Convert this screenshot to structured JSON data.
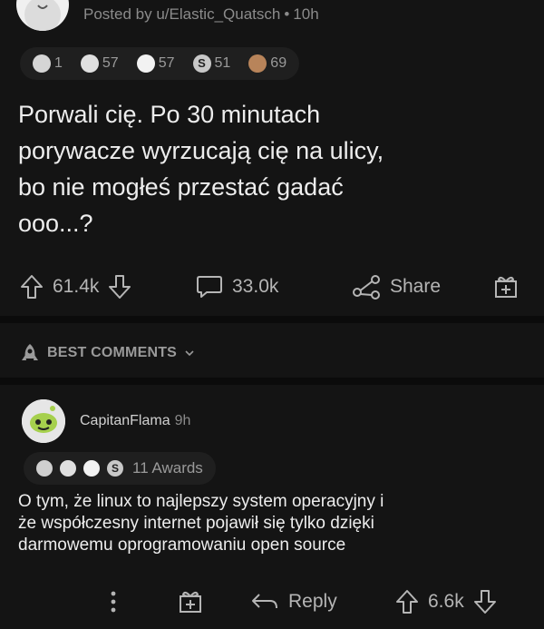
{
  "post": {
    "posted_by": "Posted by u/Elastic_Quatsch",
    "age": "10h",
    "awards": [
      {
        "icon": "helpful-award-icon",
        "count": "1",
        "color": "#d5d5d5"
      },
      {
        "icon": "hand-award-icon",
        "count": "57",
        "color": "#e0e0e0"
      },
      {
        "icon": "face-award-icon",
        "count": "57",
        "color": "#f2f2f2"
      },
      {
        "icon": "silver-s-award-icon",
        "count": "51",
        "color": "#c8c8c8"
      },
      {
        "icon": "sloth-award-icon",
        "count": "69",
        "color": "#b8845a"
      }
    ],
    "title": "Porwali cię. Po 30 minutach\nporywacze wyrzucają cię na ulicy,\nbo nie mogłeś przestać gadać\nooo...?",
    "upvotes": "61.4k",
    "comments": "33.0k",
    "share_label": "Share"
  },
  "sort": {
    "label": "BEST COMMENTS"
  },
  "comment": {
    "username": "CapitanFlama",
    "age": "9h",
    "awards_label": "11 Awards",
    "body": "O tym, że linux to najlepszy system operacyjny i\nże współczesny internet pojawił się tylko dzięki\ndarmowemu oprogramowaniu open source",
    "reply_label": "Reply",
    "upvotes": "6.6k"
  },
  "colors": {
    "background": "#141414",
    "pill": "#1f1f1f",
    "text": "#ededed",
    "muted": "#8b8b8b"
  }
}
